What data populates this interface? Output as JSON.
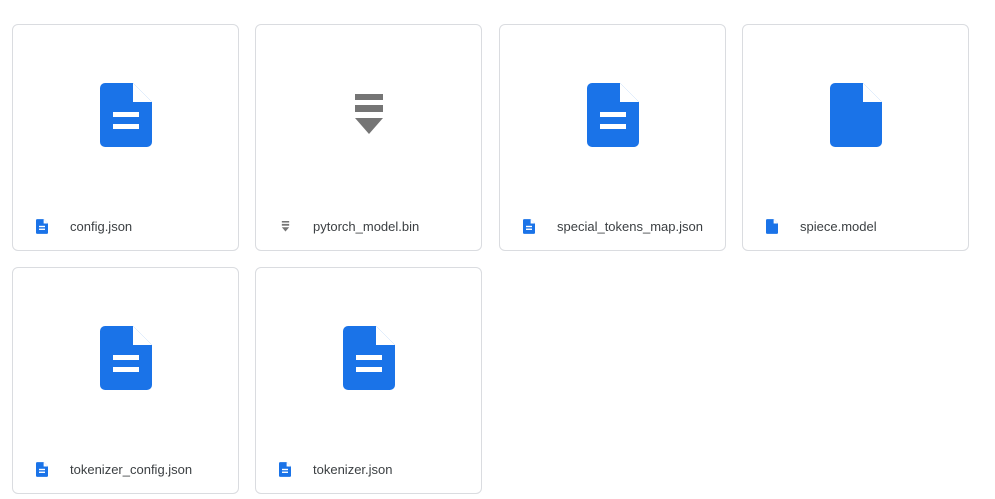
{
  "colors": {
    "doc_blue": "#1a73e8",
    "binary_gray": "#757575",
    "border": "#dadce0",
    "text": "#3c4043"
  },
  "files": [
    {
      "name": "config.json",
      "icon": "document-lines-icon"
    },
    {
      "name": "pytorch_model.bin",
      "icon": "binary-download-icon"
    },
    {
      "name": "special_tokens_map.json",
      "icon": "document-lines-icon"
    },
    {
      "name": "spiece.model",
      "icon": "blank-file-icon"
    },
    {
      "name": "tokenizer_config.json",
      "icon": "document-lines-icon"
    },
    {
      "name": "tokenizer.json",
      "icon": "document-lines-icon"
    }
  ]
}
